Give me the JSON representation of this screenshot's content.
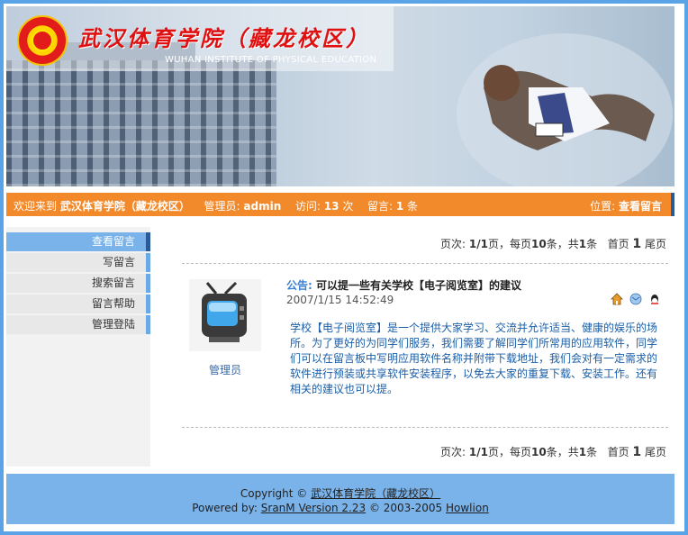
{
  "banner": {
    "title_cn": "武汉体育学院（藏龙校区）",
    "title_en": "WUHAN INSTITUTE OF PHYSICAL EDUCATION"
  },
  "infobar": {
    "welcome": "欢迎来到",
    "site_name": "武汉体育学院（藏龙校区）",
    "admin_label": "管理员:",
    "admin_value": "admin",
    "visits_label": "访问:",
    "visits_value": "13",
    "visits_unit": "次",
    "messages_label": "留言:",
    "messages_value": "1",
    "messages_unit": "条",
    "location_label": "位置:",
    "location_value": "查看留言"
  },
  "sidebar": {
    "items": [
      {
        "label": "查看留言"
      },
      {
        "label": "写留言"
      },
      {
        "label": "搜索留言"
      },
      {
        "label": "留言帮助"
      },
      {
        "label": "管理登陆"
      }
    ]
  },
  "pager": {
    "label": "页次:",
    "page": "1/1",
    "page_unit": "页，每页",
    "per_page": "10",
    "per_page_unit": "条，共",
    "total": "1",
    "total_unit": "条",
    "first": "首页",
    "current": "1",
    "last": "尾页"
  },
  "post": {
    "author": "管理员",
    "label": "公告:",
    "title": "可以提一些有关学校【电子阅览室】的建议",
    "date": "2007/1/15 14:52:49",
    "body": "学校【电子阅览室】是一个提供大家学习、交流并允许适当、健康的娱乐的场所。为了更好的为同学们服务，我们需要了解同学们所常用的应用软件，同学们可以在留言板中写明应用软件名称并附带下载地址，我们会对有一定需求的软件进行预装或共享软件安装程序，以免去大家的重复下载、安装工作。还有相关的建议也可以提。",
    "icons": [
      "home-icon",
      "email-icon",
      "qq-icon"
    ]
  },
  "footer": {
    "copyright_prefix": "Copyright ©",
    "copyright_link": "武汉体育学院（藏龙校区）",
    "powered_prefix": "Powered by:",
    "powered_link": "SranM Version 2.23",
    "powered_mid": "© 2003-2005",
    "author_link": "Howlion"
  },
  "colors": {
    "border": "#5aa3e6",
    "infobar": "#f28a2c",
    "nav_active": "#7ab3ea",
    "link": "#3b7fd0",
    "body_text": "#1a5ea8"
  }
}
